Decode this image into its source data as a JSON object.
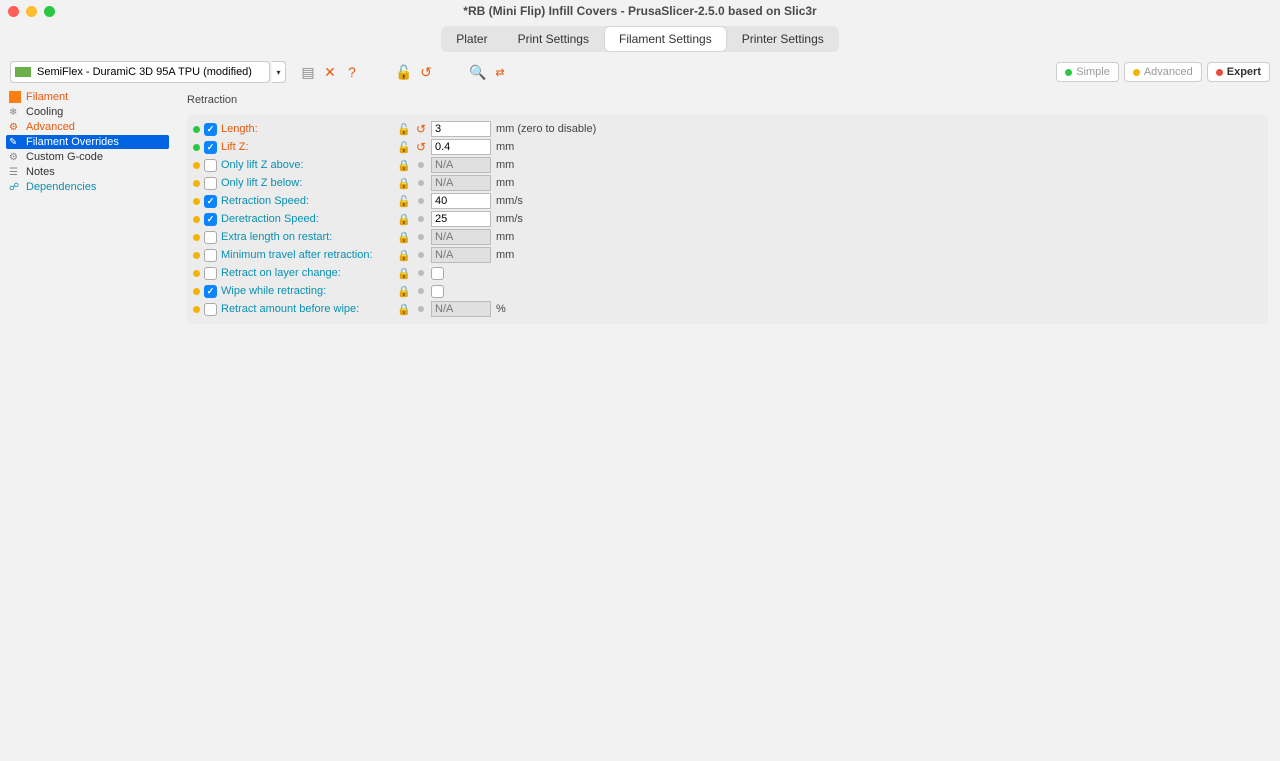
{
  "window": {
    "title": "*RB (Mini Flip) Infill Covers - PrusaSlicer-2.5.0 based on Slic3r"
  },
  "tabs": {
    "plater": "Plater",
    "print": "Print Settings",
    "filament": "Filament Settings",
    "printer": "Printer Settings"
  },
  "preset": {
    "name": "SemiFlex - DuramiC 3D 95A TPU (modified)"
  },
  "modes": {
    "simple": "Simple",
    "advanced": "Advanced",
    "expert": "Expert"
  },
  "sidebar": {
    "filament": "Filament",
    "cooling": "Cooling",
    "advanced": "Advanced",
    "overrides": "Filament Overrides",
    "gcode": "Custom G-code",
    "notes": "Notes",
    "dependencies": "Dependencies"
  },
  "section": {
    "retraction": "Retraction"
  },
  "rows": {
    "length": {
      "label": "Length:",
      "value": "3",
      "unit": "mm (zero to disable)"
    },
    "liftz": {
      "label": "Lift Z:",
      "value": "0.4",
      "unit": "mm"
    },
    "only_above": {
      "label": "Only lift Z above:",
      "placeholder": "N/A",
      "unit": "mm"
    },
    "only_below": {
      "label": "Only lift Z below:",
      "placeholder": "N/A",
      "unit": "mm"
    },
    "retr_speed": {
      "label": "Retraction Speed:",
      "value": "40",
      "unit": "mm/s"
    },
    "deretr_speed": {
      "label": "Deretraction Speed:",
      "value": "25",
      "unit": "mm/s"
    },
    "extra_restart": {
      "label": "Extra length on restart:",
      "placeholder": "N/A",
      "unit": "mm"
    },
    "min_travel": {
      "label": "Minimum travel after retraction:",
      "placeholder": "N/A",
      "unit": "mm"
    },
    "layer_change": {
      "label": "Retract on layer change:"
    },
    "wipe": {
      "label": "Wipe while retracting:"
    },
    "wipe_amount": {
      "label": "Retract amount before wipe:",
      "placeholder": "N/A",
      "unit": "%"
    }
  }
}
